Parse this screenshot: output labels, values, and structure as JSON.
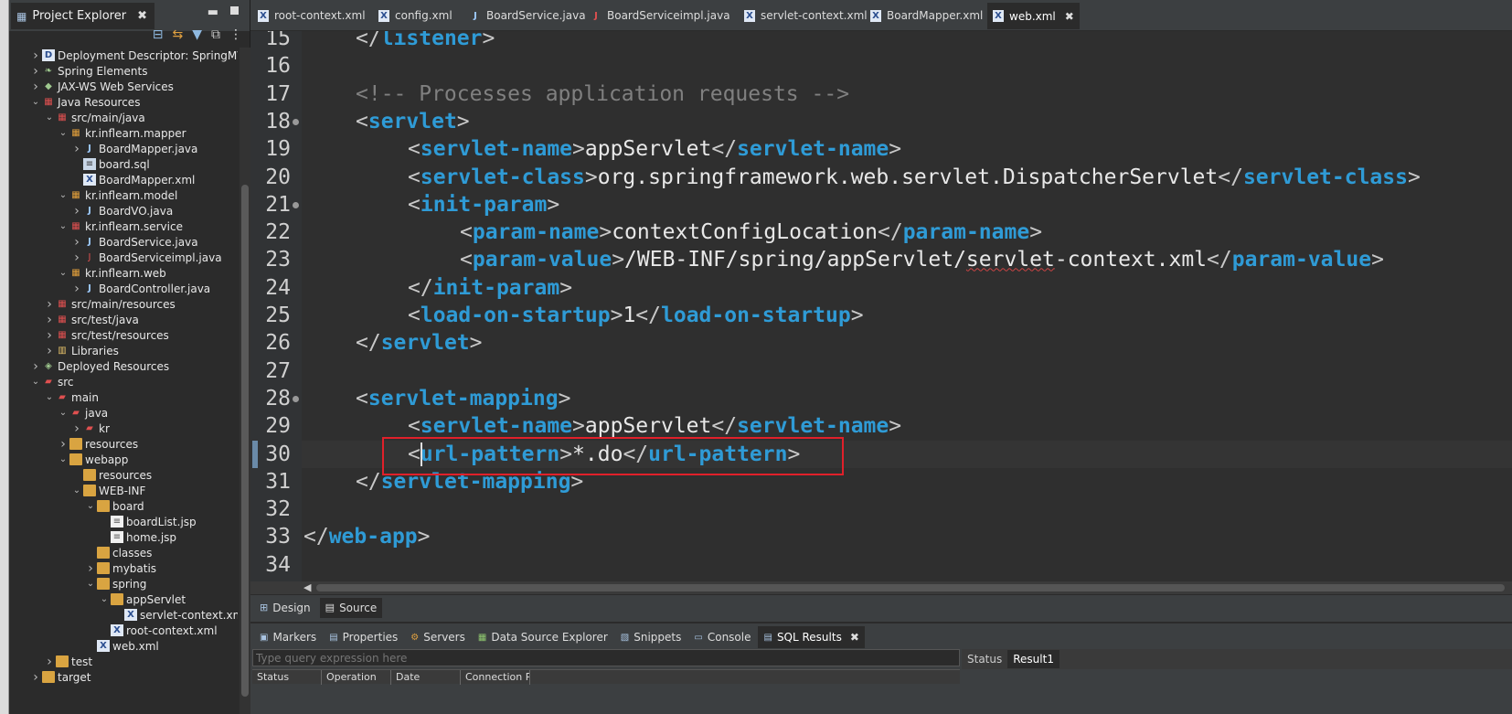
{
  "explorer": {
    "title": "Project Explorer",
    "tree": [
      {
        "label": "Deployment Descriptor: SpringMVC(",
        "depth": 0,
        "arrow": "right",
        "icon": "descriptor"
      },
      {
        "label": "Spring Elements",
        "depth": 0,
        "arrow": "right",
        "icon": "spring"
      },
      {
        "label": "JAX-WS Web Services",
        "depth": 0,
        "arrow": "right",
        "icon": "webservice"
      },
      {
        "label": "Java Resources",
        "depth": 0,
        "arrow": "down",
        "icon": "java-resources"
      },
      {
        "label": "src/main/java",
        "depth": 1,
        "arrow": "down",
        "icon": "source-folder"
      },
      {
        "label": "kr.inflearn.mapper",
        "depth": 2,
        "arrow": "down",
        "icon": "package"
      },
      {
        "label": "BoardMapper.java",
        "depth": 3,
        "arrow": "right",
        "icon": "java-file"
      },
      {
        "label": "board.sql",
        "depth": 3,
        "arrow": "",
        "icon": "sql-file"
      },
      {
        "label": "BoardMapper.xml",
        "depth": 3,
        "arrow": "",
        "icon": "xml-file"
      },
      {
        "label": "kr.inflearn.model",
        "depth": 2,
        "arrow": "down",
        "icon": "package"
      },
      {
        "label": "BoardVO.java",
        "depth": 3,
        "arrow": "right",
        "icon": "java-file"
      },
      {
        "label": "kr.inflearn.service",
        "depth": 2,
        "arrow": "down",
        "icon": "package-error"
      },
      {
        "label": "BoardService.java",
        "depth": 3,
        "arrow": "right",
        "icon": "java-file"
      },
      {
        "label": "BoardServiceimpl.java",
        "depth": 3,
        "arrow": "right",
        "icon": "java-file-error"
      },
      {
        "label": "kr.inflearn.web",
        "depth": 2,
        "arrow": "down",
        "icon": "package"
      },
      {
        "label": "BoardController.java",
        "depth": 3,
        "arrow": "right",
        "icon": "java-file"
      },
      {
        "label": "src/main/resources",
        "depth": 1,
        "arrow": "right",
        "icon": "source-folder"
      },
      {
        "label": "src/test/java",
        "depth": 1,
        "arrow": "right",
        "icon": "source-folder"
      },
      {
        "label": "src/test/resources",
        "depth": 1,
        "arrow": "right",
        "icon": "source-folder"
      },
      {
        "label": "Libraries",
        "depth": 1,
        "arrow": "right",
        "icon": "library"
      },
      {
        "label": "Deployed Resources",
        "depth": 0,
        "arrow": "right",
        "icon": "deployed"
      },
      {
        "label": "src",
        "depth": 0,
        "arrow": "down",
        "icon": "folder-error"
      },
      {
        "label": "main",
        "depth": 1,
        "arrow": "down",
        "icon": "folder-error"
      },
      {
        "label": "java",
        "depth": 2,
        "arrow": "down",
        "icon": "folder-error"
      },
      {
        "label": "kr",
        "depth": 3,
        "arrow": "right",
        "icon": "folder-error"
      },
      {
        "label": "resources",
        "depth": 2,
        "arrow": "right",
        "icon": "folder"
      },
      {
        "label": "webapp",
        "depth": 2,
        "arrow": "down",
        "icon": "folder"
      },
      {
        "label": "resources",
        "depth": 3,
        "arrow": "",
        "icon": "folder"
      },
      {
        "label": "WEB-INF",
        "depth": 3,
        "arrow": "down",
        "icon": "folder"
      },
      {
        "label": "board",
        "depth": 4,
        "arrow": "down",
        "icon": "folder"
      },
      {
        "label": "boardList.jsp",
        "depth": 5,
        "arrow": "",
        "icon": "jsp-file"
      },
      {
        "label": "home.jsp",
        "depth": 5,
        "arrow": "",
        "icon": "jsp-file"
      },
      {
        "label": "classes",
        "depth": 4,
        "arrow": "",
        "icon": "folder"
      },
      {
        "label": "mybatis",
        "depth": 4,
        "arrow": "right",
        "icon": "folder"
      },
      {
        "label": "spring",
        "depth": 4,
        "arrow": "down",
        "icon": "folder"
      },
      {
        "label": "appServlet",
        "depth": 5,
        "arrow": "down",
        "icon": "folder"
      },
      {
        "label": "servlet-context.xml",
        "depth": 6,
        "arrow": "",
        "icon": "xml-file"
      },
      {
        "label": "root-context.xml",
        "depth": 5,
        "arrow": "",
        "icon": "xml-file"
      },
      {
        "label": "web.xml",
        "depth": 4,
        "arrow": "",
        "icon": "xml-file"
      },
      {
        "label": "test",
        "depth": 1,
        "arrow": "right",
        "icon": "folder"
      },
      {
        "label": "target",
        "depth": 0,
        "arrow": "right",
        "icon": "folder"
      }
    ]
  },
  "editor_tabs": [
    {
      "label": "root-context.xml",
      "icon": "xml-file",
      "active": false
    },
    {
      "label": "config.xml",
      "icon": "xml-file",
      "active": false
    },
    {
      "label": "BoardService.java",
      "icon": "java-file",
      "active": false
    },
    {
      "label": "BoardServiceimpl.java",
      "icon": "java-file-error",
      "active": false
    },
    {
      "label": "servlet-context.xml",
      "icon": "xml-file",
      "active": false
    },
    {
      "label": "BoardMapper.xml",
      "icon": "xml-file",
      "active": false
    },
    {
      "label": "web.xml",
      "icon": "xml-file",
      "active": true
    }
  ],
  "editor": {
    "current_line": 30,
    "lines": [
      {
        "num": "15",
        "indent": 1,
        "tokens": [
          [
            "tg",
            "</"
          ],
          [
            "tn",
            "listener"
          ],
          [
            "tg",
            ">"
          ]
        ]
      },
      {
        "num": "16",
        "indent": 0,
        "tokens": []
      },
      {
        "num": "17",
        "indent": 1,
        "tokens": [
          [
            "cm",
            "<!-- Processes application requests -->"
          ]
        ]
      },
      {
        "num": "18",
        "indent": 1,
        "fold": true,
        "tokens": [
          [
            "tg",
            "<"
          ],
          [
            "tn",
            "servlet"
          ],
          [
            "tg",
            ">"
          ]
        ]
      },
      {
        "num": "19",
        "indent": 2,
        "tokens": [
          [
            "tg",
            "<"
          ],
          [
            "tn",
            "servlet-name"
          ],
          [
            "tg",
            ">"
          ],
          [
            "tx",
            "appServlet"
          ],
          [
            "tg",
            "</"
          ],
          [
            "tn",
            "servlet-name"
          ],
          [
            "tg",
            ">"
          ]
        ]
      },
      {
        "num": "20",
        "indent": 2,
        "tokens": [
          [
            "tg",
            "<"
          ],
          [
            "tn",
            "servlet-class"
          ],
          [
            "tg",
            ">"
          ],
          [
            "tx",
            "org.springframework.web.servlet.DispatcherServlet"
          ],
          [
            "tg",
            "</"
          ],
          [
            "tn",
            "servlet-class"
          ],
          [
            "tg",
            ">"
          ]
        ]
      },
      {
        "num": "21",
        "indent": 2,
        "fold": true,
        "tokens": [
          [
            "tg",
            "<"
          ],
          [
            "tn",
            "init-param"
          ],
          [
            "tg",
            ">"
          ]
        ]
      },
      {
        "num": "22",
        "indent": 3,
        "tokens": [
          [
            "tg",
            "<"
          ],
          [
            "tn",
            "param-name"
          ],
          [
            "tg",
            ">"
          ],
          [
            "tx",
            "contextConfigLocation"
          ],
          [
            "tg",
            "</"
          ],
          [
            "tn",
            "param-name"
          ],
          [
            "tg",
            ">"
          ]
        ]
      },
      {
        "num": "23",
        "indent": 3,
        "tokens": [
          [
            "tg",
            "<"
          ],
          [
            "tn",
            "param-value"
          ],
          [
            "tg",
            ">"
          ],
          [
            "tx",
            "/WEB-INF/spring/appServlet/"
          ],
          [
            "sq",
            "servlet"
          ],
          [
            "tx",
            "-context.xml"
          ],
          [
            "tg",
            "</"
          ],
          [
            "tn",
            "param-value"
          ],
          [
            "tg",
            ">"
          ]
        ]
      },
      {
        "num": "24",
        "indent": 2,
        "tokens": [
          [
            "tg",
            "</"
          ],
          [
            "tn",
            "init-param"
          ],
          [
            "tg",
            ">"
          ]
        ]
      },
      {
        "num": "25",
        "indent": 2,
        "tokens": [
          [
            "tg",
            "<"
          ],
          [
            "tn",
            "load-on-startup"
          ],
          [
            "tg",
            ">"
          ],
          [
            "tx",
            "1"
          ],
          [
            "tg",
            "</"
          ],
          [
            "tn",
            "load-on-startup"
          ],
          [
            "tg",
            ">"
          ]
        ]
      },
      {
        "num": "26",
        "indent": 1,
        "tokens": [
          [
            "tg",
            "</"
          ],
          [
            "tn",
            "servlet"
          ],
          [
            "tg",
            ">"
          ]
        ]
      },
      {
        "num": "27",
        "indent": 0,
        "tokens": []
      },
      {
        "num": "28",
        "indent": 1,
        "fold": true,
        "tokens": [
          [
            "tg",
            "<"
          ],
          [
            "tn",
            "servlet-mapping"
          ],
          [
            "tg",
            ">"
          ]
        ]
      },
      {
        "num": "29",
        "indent": 2,
        "tokens": [
          [
            "tg",
            "<"
          ],
          [
            "tn",
            "servlet-name"
          ],
          [
            "tg",
            ">"
          ],
          [
            "tx",
            "appServlet"
          ],
          [
            "tg",
            "</"
          ],
          [
            "tn",
            "servlet-name"
          ],
          [
            "tg",
            ">"
          ]
        ]
      },
      {
        "num": "30",
        "indent": 2,
        "tokens": [
          [
            "tg",
            "<"
          ],
          [
            "tn",
            "url-pattern"
          ],
          [
            "tg",
            ">"
          ],
          [
            "tx",
            "*.do"
          ],
          [
            "tg",
            "</"
          ],
          [
            "tn",
            "url-pattern"
          ],
          [
            "tg",
            ">"
          ]
        ]
      },
      {
        "num": "31",
        "indent": 1,
        "tokens": [
          [
            "tg",
            "</"
          ],
          [
            "tn",
            "servlet-mapping"
          ],
          [
            "tg",
            ">"
          ]
        ]
      },
      {
        "num": "32",
        "indent": 0,
        "tokens": []
      },
      {
        "num": "33",
        "indent": 0,
        "tokens": [
          [
            "tg",
            "</"
          ],
          [
            "tn",
            "web-app"
          ],
          [
            "tg",
            ">"
          ]
        ]
      },
      {
        "num": "34",
        "indent": 0,
        "tokens": []
      }
    ]
  },
  "design_source_tabs": [
    {
      "label": "Design",
      "active": false
    },
    {
      "label": "Source",
      "active": true
    }
  ],
  "bottom_tabs": [
    {
      "label": "Markers",
      "active": false
    },
    {
      "label": "Properties",
      "active": false
    },
    {
      "label": "Servers",
      "active": false
    },
    {
      "label": "Data Source Explorer",
      "active": false
    },
    {
      "label": "Snippets",
      "active": false
    },
    {
      "label": "Console",
      "active": false
    },
    {
      "label": "SQL Results",
      "active": true
    }
  ],
  "sql_results": {
    "query_placeholder": "Type query expression here",
    "columns": [
      "Status",
      "Operation",
      "Date",
      "Connection P"
    ],
    "result_tabs": [
      "Status",
      "Result1"
    ]
  },
  "colors": {
    "tag_name": "#2f9bd6",
    "highlight_box": "#e0202a",
    "editor_bg": "#2f2f2f"
  }
}
